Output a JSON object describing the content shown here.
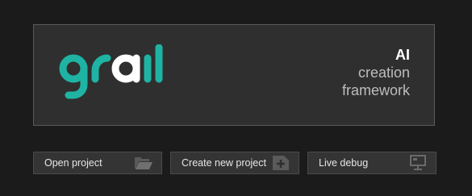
{
  "logo": {
    "text": "grail",
    "color": "#1fb3a3",
    "accent": "#ffffff"
  },
  "tagline": {
    "line1": "AI",
    "line2": "creation",
    "line3": "framework"
  },
  "buttons": [
    {
      "label": "Open project",
      "icon": "folder-open-icon"
    },
    {
      "label": "Create new project",
      "icon": "plus-icon"
    },
    {
      "label": "Live debug",
      "icon": "monitor-icon"
    }
  ]
}
